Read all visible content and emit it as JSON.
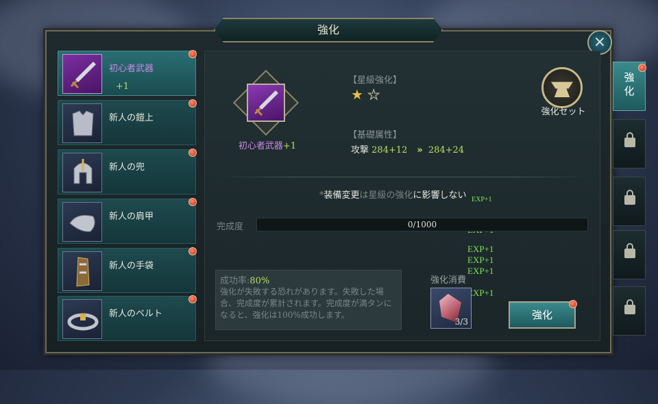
{
  "title": "強化",
  "close_icon": "close-icon",
  "equipment": [
    {
      "name": "初心者武器",
      "level": "+1",
      "selected": true
    },
    {
      "name": "新人の鎧上"
    },
    {
      "name": "新人の兜"
    },
    {
      "name": "新人の肩甲"
    },
    {
      "name": "新人の手袋"
    },
    {
      "name": "新人のベルト"
    }
  ],
  "detail": {
    "item_name": "初心者武器",
    "item_level": "+1",
    "star_label": "【星級強化】",
    "stars_filled": 1,
    "stars_total": 2,
    "base_label": "【基礎属性】",
    "attr_name": "攻撃",
    "attr_current": "284+12",
    "attr_next": "284+24",
    "notice_pre": "*",
    "notice_w1": "装備変更",
    "notice_mid": "は星級の強化",
    "notice_w2": "に影響しない",
    "progress_label": "完成度",
    "progress_text": "0/1000",
    "progress_value": 0,
    "rate_label": "成功率:",
    "rate_value": "80%",
    "rate_desc": "強化が失敗する恐れがあります。失敗した場合、完成度が累計されます。完成度が満タンになると、強化は100%成功します。",
    "cost_label": "強化消費",
    "cost_count": "3/3",
    "enhance_button": "強化",
    "set_button": "強化セット"
  },
  "floating_exp": [
    "EXP+1",
    "EXP+1",
    "EXP+1",
    "EXP+1",
    "EXP+1",
    "EXP+1"
  ],
  "side_tabs": [
    {
      "label": "強化",
      "active": true
    },
    {
      "icon": "lock-icon"
    },
    {
      "icon": "lock-icon"
    },
    {
      "icon": "lock-icon"
    },
    {
      "icon": "lock-icon"
    }
  ],
  "colors": {
    "accent": "#b8e060",
    "selected_name": "#c78ae6",
    "exp": "#7ee05a"
  }
}
